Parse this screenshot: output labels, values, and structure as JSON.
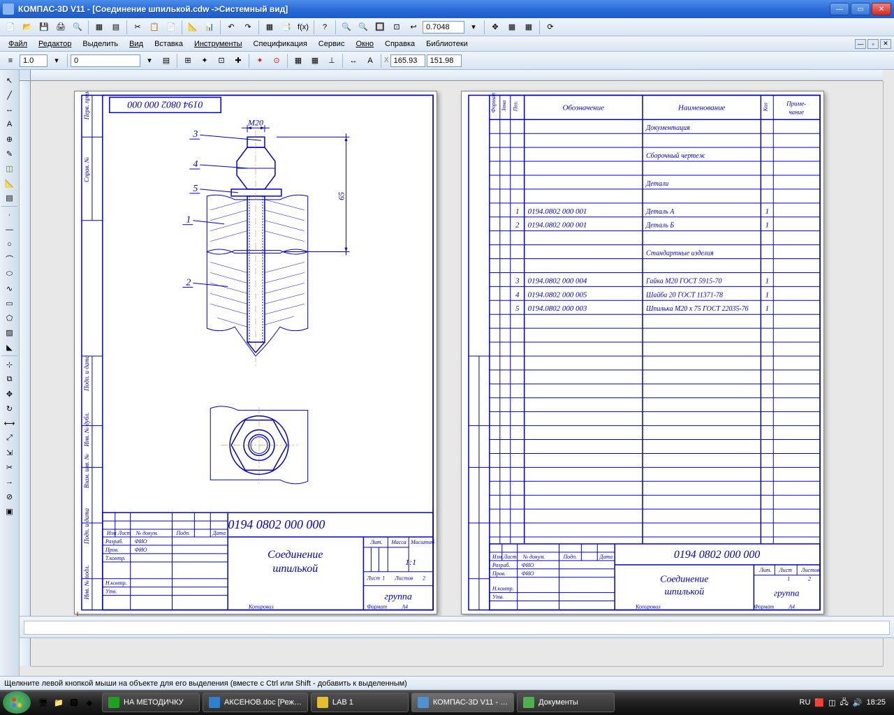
{
  "window": {
    "title": "КОМПАС-3D V11 - [Соединение шпилькой.cdw ->Системный вид]"
  },
  "menu": {
    "items": [
      "Файл",
      "Редактор",
      "Выделить",
      "Вид",
      "Вставка",
      "Инструменты",
      "Спецификация",
      "Сервис",
      "Окно",
      "Справка",
      "Библиотеки"
    ]
  },
  "toolbar2": {
    "zoom": "0.7048"
  },
  "toolbar3": {
    "num1": "1.0",
    "num2": "0",
    "coord_x": "165.93",
    "coord_y": "151.98"
  },
  "sheet1": {
    "docnum_rot": "0194 0802 000 000",
    "dim_label": "M20",
    "dim_height": "65",
    "callouts": [
      "3",
      "4",
      "5",
      "1",
      "2"
    ],
    "title_num": "0194 0802 000 000",
    "title_name1": "Соединение",
    "title_name2": "шпилькой",
    "scale": "1:1",
    "group": "группа",
    "sheet_no": "1",
    "sheets_total": "2",
    "format": "А4",
    "labels": {
      "razrab": "Разраб.",
      "prov": "Пров.",
      "tkontr": "Т.контр.",
      "nkontr": "Н.контр.",
      "utv": "Утв.",
      "fio": "ФИО",
      "izm": "Изм",
      "list": "Лист",
      "ndokum": "№ докум.",
      "podp": "Подп.",
      "data": "Дата",
      "lit": "Лит.",
      "massa": "Масса",
      "masshtab": "Масштаб",
      "listov": "Листов",
      "kopiroval": "Копировал",
      "format_lbl": "Формат",
      "perv_primen": "Перв. примен.",
      "sprav": "Справ. №",
      "podp_data": "Подп. и дата",
      "inv_dubl": "Инв. № дубл.",
      "vzam_inv": "Взам. инв. №",
      "inv_podl": "Инв. № подл."
    }
  },
  "sheet2": {
    "headers": {
      "format": "Формат",
      "zona": "Зона",
      "poz": "Поз.",
      "obozn": "Обозначение",
      "naim": "Наименование",
      "kol": "Кол",
      "prim": "Приме-\nчание"
    },
    "rows": [
      {
        "poz": "",
        "obozn": "",
        "naim": "Документация",
        "kol": ""
      },
      {
        "poz": "",
        "obozn": "",
        "naim": "",
        "kol": ""
      },
      {
        "poz": "",
        "obozn": "",
        "naim": "Сборочный чертеж",
        "kol": ""
      },
      {
        "poz": "",
        "obozn": "",
        "naim": "",
        "kol": ""
      },
      {
        "poz": "",
        "obozn": "",
        "naim": "Детали",
        "kol": ""
      },
      {
        "poz": "",
        "obozn": "",
        "naim": "",
        "kol": ""
      },
      {
        "poz": "1",
        "obozn": "0194.0802 000 001",
        "naim": "Деталь А",
        "kol": "1"
      },
      {
        "poz": "2",
        "obozn": "0194.0802 000 001",
        "naim": "Деталь Б",
        "kol": "1"
      },
      {
        "poz": "",
        "obozn": "",
        "naim": "",
        "kol": ""
      },
      {
        "poz": "",
        "obozn": "",
        "naim": "Стандартные изделия",
        "kol": ""
      },
      {
        "poz": "",
        "obozn": "",
        "naim": "",
        "kol": ""
      },
      {
        "poz": "3",
        "obozn": "0194.0802 000 004",
        "naim": "Гайка М20 ГОСТ 5915-70",
        "kol": "1"
      },
      {
        "poz": "4",
        "obozn": "0194.0802 000 005",
        "naim": "Шайба 20 ГОСТ 11371-78",
        "kol": "1"
      },
      {
        "poz": "5",
        "obozn": "0194.0802 000 003",
        "naim": "Шпилька М20 х 75 ГОСТ 22035-76",
        "kol": "1"
      }
    ],
    "title_num": "0194 0802 000 000",
    "title_name1": "Соединение",
    "title_name2": "шпилькой",
    "group": "группа",
    "sheet_no": "1",
    "sheets_total": "2",
    "format": "А4"
  },
  "hint": "Щелкните левой кнопкой мыши на объекте для его выделения (вместе с Ctrl или Shift - добавить к выделенным)",
  "taskbar": {
    "tasks": [
      {
        "label": "НА МЕТОДИЧКУ",
        "active": false,
        "color": "#20a020"
      },
      {
        "label": "АКСЕНОВ.doc [Реж…",
        "active": false,
        "color": "#3080d0"
      },
      {
        "label": "LAB 1",
        "active": false,
        "color": "#e0c030"
      },
      {
        "label": "КОМПАС-3D V11 - …",
        "active": true,
        "color": "#5090d0"
      },
      {
        "label": "Документы",
        "active": false,
        "color": "#50b050"
      }
    ],
    "lang": "RU",
    "time": "18:25"
  }
}
